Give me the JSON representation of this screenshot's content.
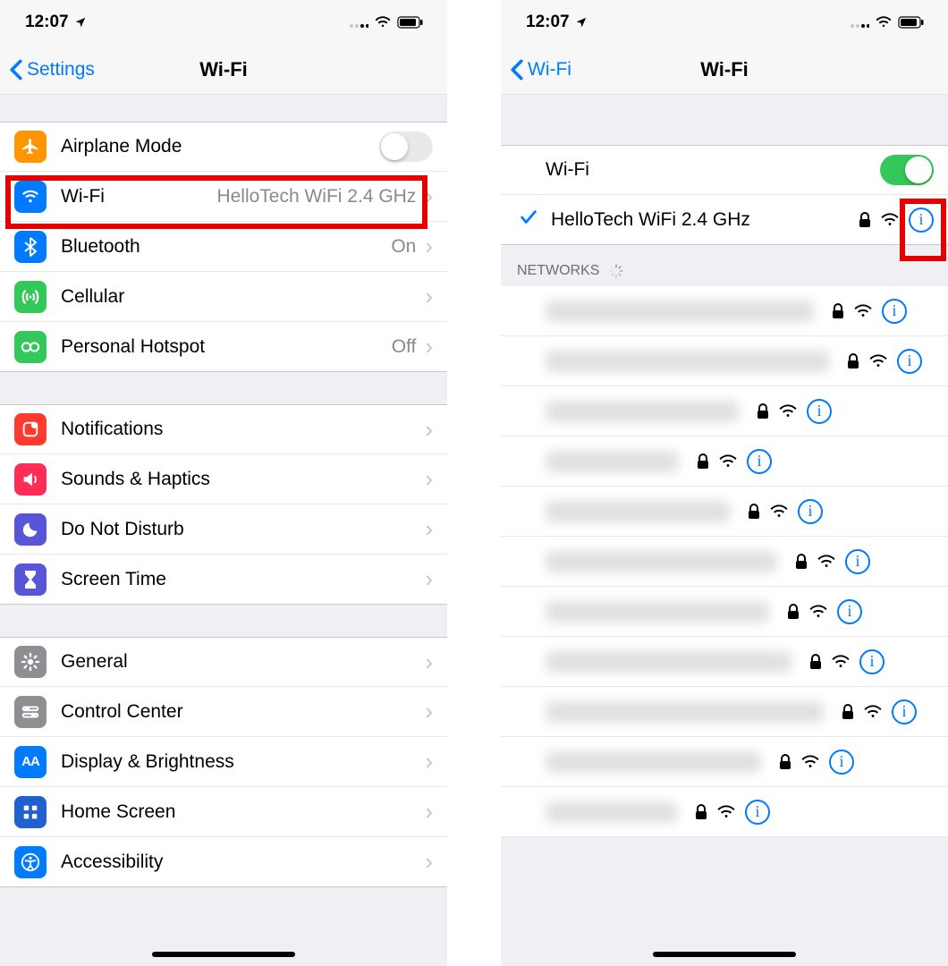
{
  "statusBar": {
    "time": "12:07"
  },
  "left": {
    "back": "Settings",
    "title": "Wi-Fi",
    "group1": [
      {
        "icon": "airplane",
        "bg": "#ff9500",
        "label": "Airplane Mode",
        "toggle": "off"
      },
      {
        "icon": "wifi",
        "bg": "#007aff",
        "label": "Wi-Fi",
        "detail": "HelloTech WiFi 2.4 GHz",
        "chevron": true
      },
      {
        "icon": "bluetooth",
        "bg": "#007aff",
        "label": "Bluetooth",
        "detail": "On",
        "chevron": true
      },
      {
        "icon": "cellular",
        "bg": "#34c759",
        "label": "Cellular",
        "chevron": true
      },
      {
        "icon": "hotspot",
        "bg": "#34c759",
        "label": "Personal Hotspot",
        "detail": "Off",
        "chevron": true
      }
    ],
    "group2": [
      {
        "icon": "notifications",
        "bg": "#ff3b30",
        "label": "Notifications",
        "chevron": true
      },
      {
        "icon": "sounds",
        "bg": "#ff2d55",
        "label": "Sounds & Haptics",
        "chevron": true
      },
      {
        "icon": "dnd",
        "bg": "#5856d6",
        "label": "Do Not Disturb",
        "chevron": true
      },
      {
        "icon": "screentime",
        "bg": "#5856d6",
        "label": "Screen Time",
        "chevron": true
      }
    ],
    "group3": [
      {
        "icon": "general",
        "bg": "#8e8e93",
        "label": "General",
        "chevron": true
      },
      {
        "icon": "control",
        "bg": "#8e8e93",
        "label": "Control Center",
        "chevron": true
      },
      {
        "icon": "display",
        "bg": "#007aff",
        "label": "Display & Brightness",
        "chevron": true
      },
      {
        "icon": "home",
        "bg": "#2161cf",
        "label": "Home Screen",
        "chevron": true
      },
      {
        "icon": "accessibility",
        "bg": "#007aff",
        "label": "Accessibility",
        "chevron": true
      }
    ]
  },
  "right": {
    "back": "Wi-Fi",
    "title": "Wi-Fi",
    "wifiLabel": "Wi-Fi",
    "wifiToggle": "on",
    "connected": "HelloTech WiFi 2.4 GHz",
    "networksHeader": "NETWORKS",
    "networkCount": 11
  }
}
